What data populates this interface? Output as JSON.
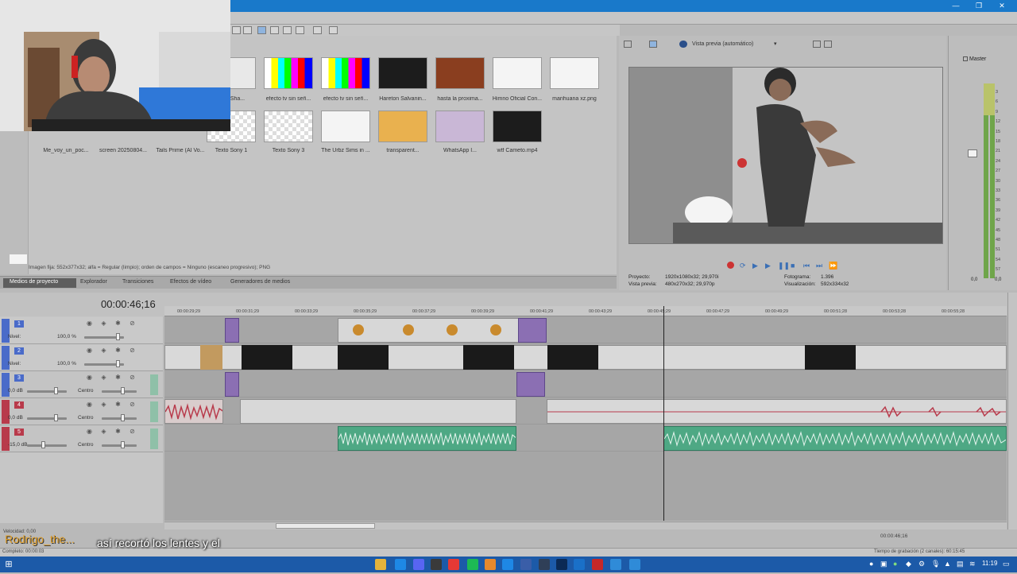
{
  "window": {
    "minimize_glyph": "—",
    "maximize_glyph": "❐",
    "close_glyph": "✕"
  },
  "media": {
    "items_row1": [
      {
        "label": "...n - Sha...",
        "kind": "image"
      },
      {
        "label": "efecto tv sin señ...",
        "kind": "bars"
      },
      {
        "label": "efecto tv sin señ...",
        "kind": "bars"
      },
      {
        "label": "Hareton Salvanin...",
        "kind": "dark"
      },
      {
        "label": "hasta la proxima...",
        "kind": "room"
      },
      {
        "label": "Himno Oficial Con...",
        "kind": "audio"
      },
      {
        "label": "marihuana xz.png",
        "kind": "leaf"
      }
    ],
    "items_row2": [
      {
        "label": "Me_voy_un_poc...",
        "kind": "webcam"
      },
      {
        "label": "screen 20250804...",
        "kind": "webcam"
      },
      {
        "label": "Tails Prime (AI Vo...",
        "kind": "webcam"
      },
      {
        "label": "Texto Sony 1",
        "kind": "transparent"
      },
      {
        "label": "Texto Sony 3",
        "kind": "transparent"
      },
      {
        "label": "The Urbz Sims in ...",
        "kind": "audio"
      },
      {
        "label": "transparent...",
        "kind": "fox"
      },
      {
        "label": "WhatsApp I...",
        "kind": "character"
      },
      {
        "label": "wtf Cameto.mp4",
        "kind": "dark"
      }
    ],
    "status_text": "Imagen fija: 552x377x32; alfa = Regular (limpio); orden de campos = Ninguno (escaneo progresivo); PNG",
    "tabs": [
      "Medios de proyecto",
      "Explorador",
      "Transiciones",
      "Efectos de vídeo",
      "Generadores de medios"
    ]
  },
  "preview": {
    "mode_label": "Vista previa (automático)",
    "project_label": "Proyecto:",
    "project_value": "1920x1080x32; 29,970i",
    "preview_label": "Vista previa:",
    "preview_value": "480x270x32; 29,970p",
    "frame_label": "Fotograma:",
    "frame_value": "1.396",
    "display_label": "Visualización:",
    "display_value": "592x334x32"
  },
  "master": {
    "title": "Master",
    "scale": [
      "3",
      "6",
      "9",
      "12",
      "15",
      "18",
      "21",
      "24",
      "27",
      "30",
      "33",
      "36",
      "39",
      "42",
      "45",
      "48",
      "51",
      "54",
      "57"
    ],
    "bottom_left": "0,0",
    "bottom_right": "0,0"
  },
  "timeline": {
    "timecode": "00:00:46;16",
    "ruler_ticks": [
      "00:00:29;29",
      "00:00:31;29",
      "00:00:33;29",
      "00:00:35;29",
      "00:00:37;29",
      "00:00:39;29",
      "00:00:41;29",
      "00:00:43;29",
      "00:00:45;29",
      "00:00:47;29",
      "00:00:49;29",
      "00:00:51;28",
      "00:00:53;28",
      "00:00:55;28"
    ],
    "tracks": [
      {
        "num": "1",
        "kind": "video",
        "level_label": "Nivel:",
        "level_value": "100,0 %"
      },
      {
        "num": "2",
        "kind": "video",
        "level_label": "Nivel:",
        "level_value": "100,0 %"
      },
      {
        "num": "3",
        "kind": "audio",
        "gain": "0,0 dB",
        "pan": "Centro"
      },
      {
        "num": "4",
        "kind": "audio",
        "gain": "0,0 dB",
        "pan": "Centro"
      },
      {
        "num": "5",
        "kind": "audio",
        "gain": "-15,0 dB",
        "pan": "Centro"
      }
    ],
    "velocity_label": "Velocidad: 0,00",
    "complete_label": "Completo: 00:00:03",
    "right_timecode": "00:00:46;16",
    "record_time": "Tiempo de grabación (2 canales): 60:15:45"
  },
  "taskbar": {
    "clock": "11:19"
  },
  "chat": {
    "user": "Rodrigo_the...",
    "message": "así recortó los lentes y el porro"
  },
  "colors": {
    "titlebar": "#1979ca",
    "video_track": "#4a6bc9",
    "audio_track": "#b83a4b",
    "audio_green": "#4ea884"
  }
}
